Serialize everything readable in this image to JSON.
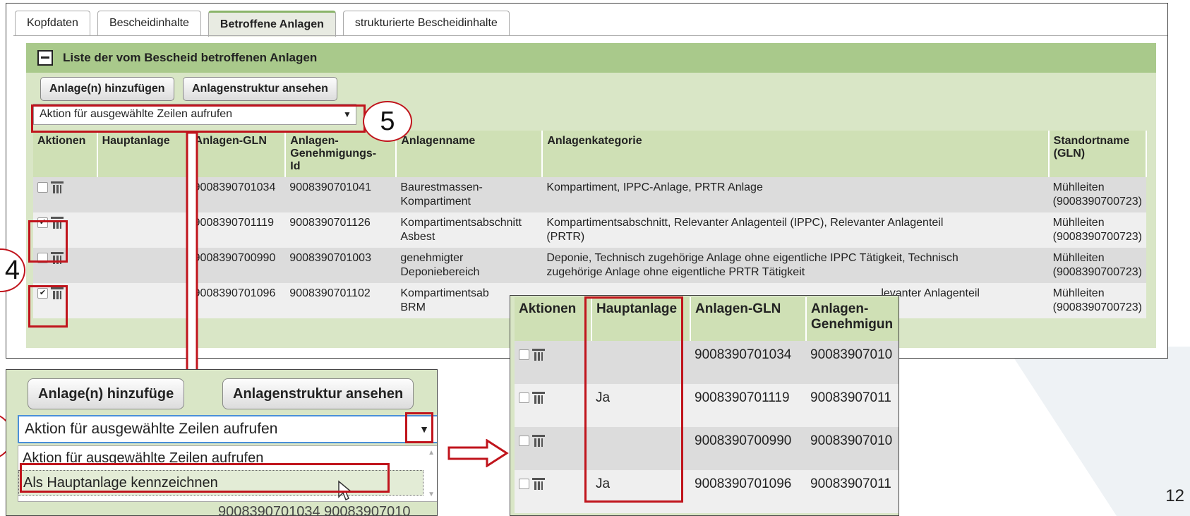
{
  "tabs": [
    {
      "label": "Kopfdaten",
      "active": false
    },
    {
      "label": "Bescheidinhalte",
      "active": false
    },
    {
      "label": "Betroffene Anlagen",
      "active": true
    },
    {
      "label": "strukturierte Bescheidinhalte",
      "active": false
    }
  ],
  "panel": {
    "title": "Liste der vom Bescheid betroffenen Anlagen",
    "add_button": "Anlage(n) hinzufügen",
    "structure_button": "Anlagenstruktur ansehen",
    "action_select": "Aktion für ausgewählte Zeilen aufrufen"
  },
  "table": {
    "headers": [
      "Aktionen",
      "Hauptanlage",
      "Anlagen-GLN",
      "Anlagen-Genehmigungs-Id",
      "Anlagenname",
      "Anlagenkategorie",
      "Standortname (GLN)"
    ],
    "header_parts": {
      "genehmigung_1": "Anlagen-",
      "genehmigung_2": "Genehmigungs-",
      "genehmigung_3": "Id",
      "standort_1": "Standortname",
      "standort_2": "(GLN)"
    },
    "rows": [
      {
        "checked": false,
        "hauptanlage": "",
        "gln": "9008390701034",
        "gen_id": "9008390701041",
        "name_1": "Baurestmassen-",
        "name_2": "Kompartiment",
        "kat_1": "Kompartiment, IPPC-Anlage, PRTR Anlage",
        "kat_2": "",
        "standort_1": "Mühlleiten",
        "standort_2": "(9008390700723)"
      },
      {
        "checked": true,
        "hauptanlage": "",
        "gln": "9008390701119",
        "gen_id": "9008390701126",
        "name_1": "Kompartimentsabschnitt",
        "name_2": "Asbest",
        "kat_1": "Kompartimentsabschnitt, Relevanter Anlagenteil (IPPC), Relevanter Anlagenteil",
        "kat_2": "(PRTR)",
        "standort_1": "Mühlleiten",
        "standort_2": "(9008390700723)"
      },
      {
        "checked": false,
        "hauptanlage": "",
        "gln": "9008390700990",
        "gen_id": "9008390701003",
        "name_1": "genehmigter",
        "name_2": "Deponiebereich",
        "kat_1": "Deponie, Technisch zugehörige Anlage ohne eigentliche IPPC Tätigkeit, Technisch",
        "kat_2": "zugehörige Anlage ohne eigentliche PRTR Tätigkeit",
        "standort_1": "Mühlleiten",
        "standort_2": "(9008390700723)"
      },
      {
        "checked": true,
        "hauptanlage": "",
        "gln": "9008390701096",
        "gen_id": "9008390701102",
        "name_1": "Kompartimentsab",
        "name_2": "BRM",
        "kat_1": "levanter Anlagenteil",
        "kat_2": "",
        "standort_1": "Mühlleiten",
        "standort_2": "(9008390700723)"
      }
    ]
  },
  "callouts": {
    "five": "5",
    "four": "4",
    "page": "12"
  },
  "zoom_left": {
    "add_button": "Anlage(n) hinzufüge",
    "structure_button": "Anlagenstruktur ansehen",
    "select_value": "Aktion für ausgewählte Zeilen aufrufen",
    "options": [
      "Aktion für ausgewählte Zeilen aufrufen",
      "Als Hauptanlage kennzeichnen"
    ],
    "peek_text": "9008390701034  90083907010"
  },
  "zoom_right": {
    "headers": {
      "aktionen": "Aktionen",
      "haupt": "Hauptanlage",
      "gln": "Anlagen-GLN",
      "gen_1": "Anlagen-",
      "gen_2": "Genehmigun"
    },
    "rows": [
      {
        "haupt": "",
        "gln": "9008390701034",
        "gen": "90083907010"
      },
      {
        "haupt": "Ja",
        "gln": "9008390701119",
        "gen": "90083907011"
      },
      {
        "haupt": "",
        "gln": "9008390700990",
        "gen": "90083907010"
      },
      {
        "haupt": "Ja",
        "gln": "9008390701096",
        "gen": "90083907011"
      }
    ]
  },
  "colors": {
    "accent_green": "#a9c98b",
    "panel_green": "#d9e6c6",
    "highlight_red": "#c0141c"
  }
}
